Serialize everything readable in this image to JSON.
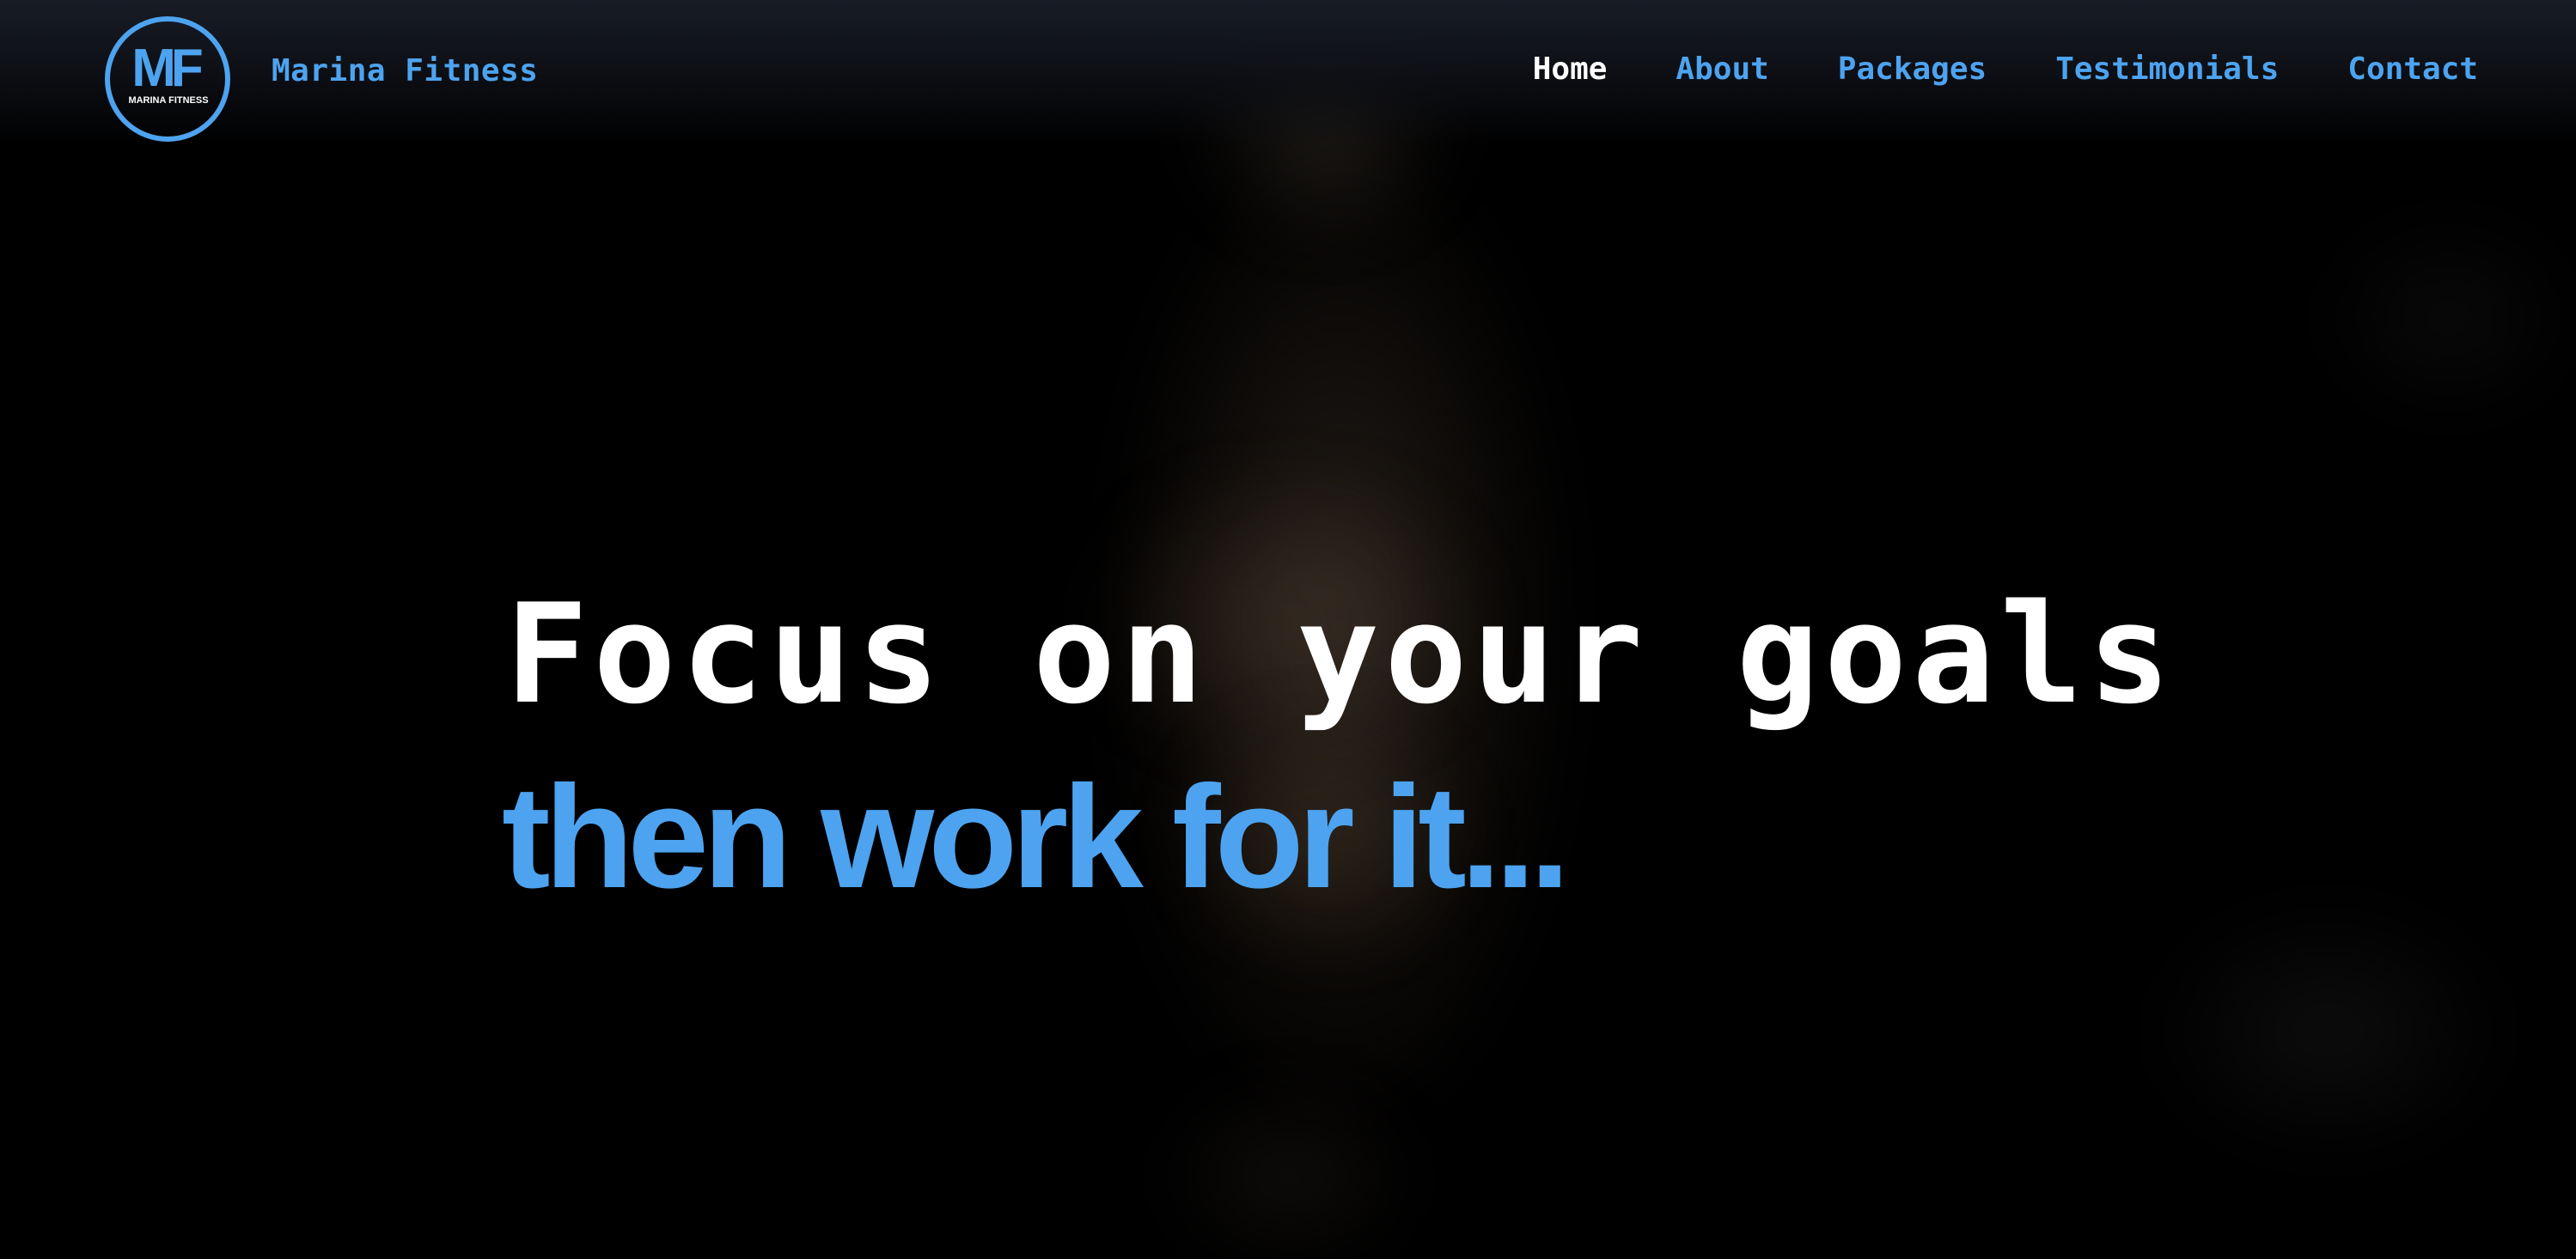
{
  "brand": {
    "name": "Marina Fitness",
    "logo_monogram": "MF",
    "logo_text": "MARINA FITNESS"
  },
  "nav": {
    "items": [
      {
        "label": "Home",
        "active": true
      },
      {
        "label": "About",
        "active": false
      },
      {
        "label": "Packages",
        "active": false
      },
      {
        "label": "Testimonials",
        "active": false
      },
      {
        "label": "Contact",
        "active": false
      }
    ]
  },
  "hero": {
    "headline": "Focus on your goals",
    "subline": "then work for it..."
  },
  "colors": {
    "accent": "#4da3ef",
    "text_primary": "#ffffff",
    "background": "#000000",
    "navbar_top": "#181c26"
  }
}
